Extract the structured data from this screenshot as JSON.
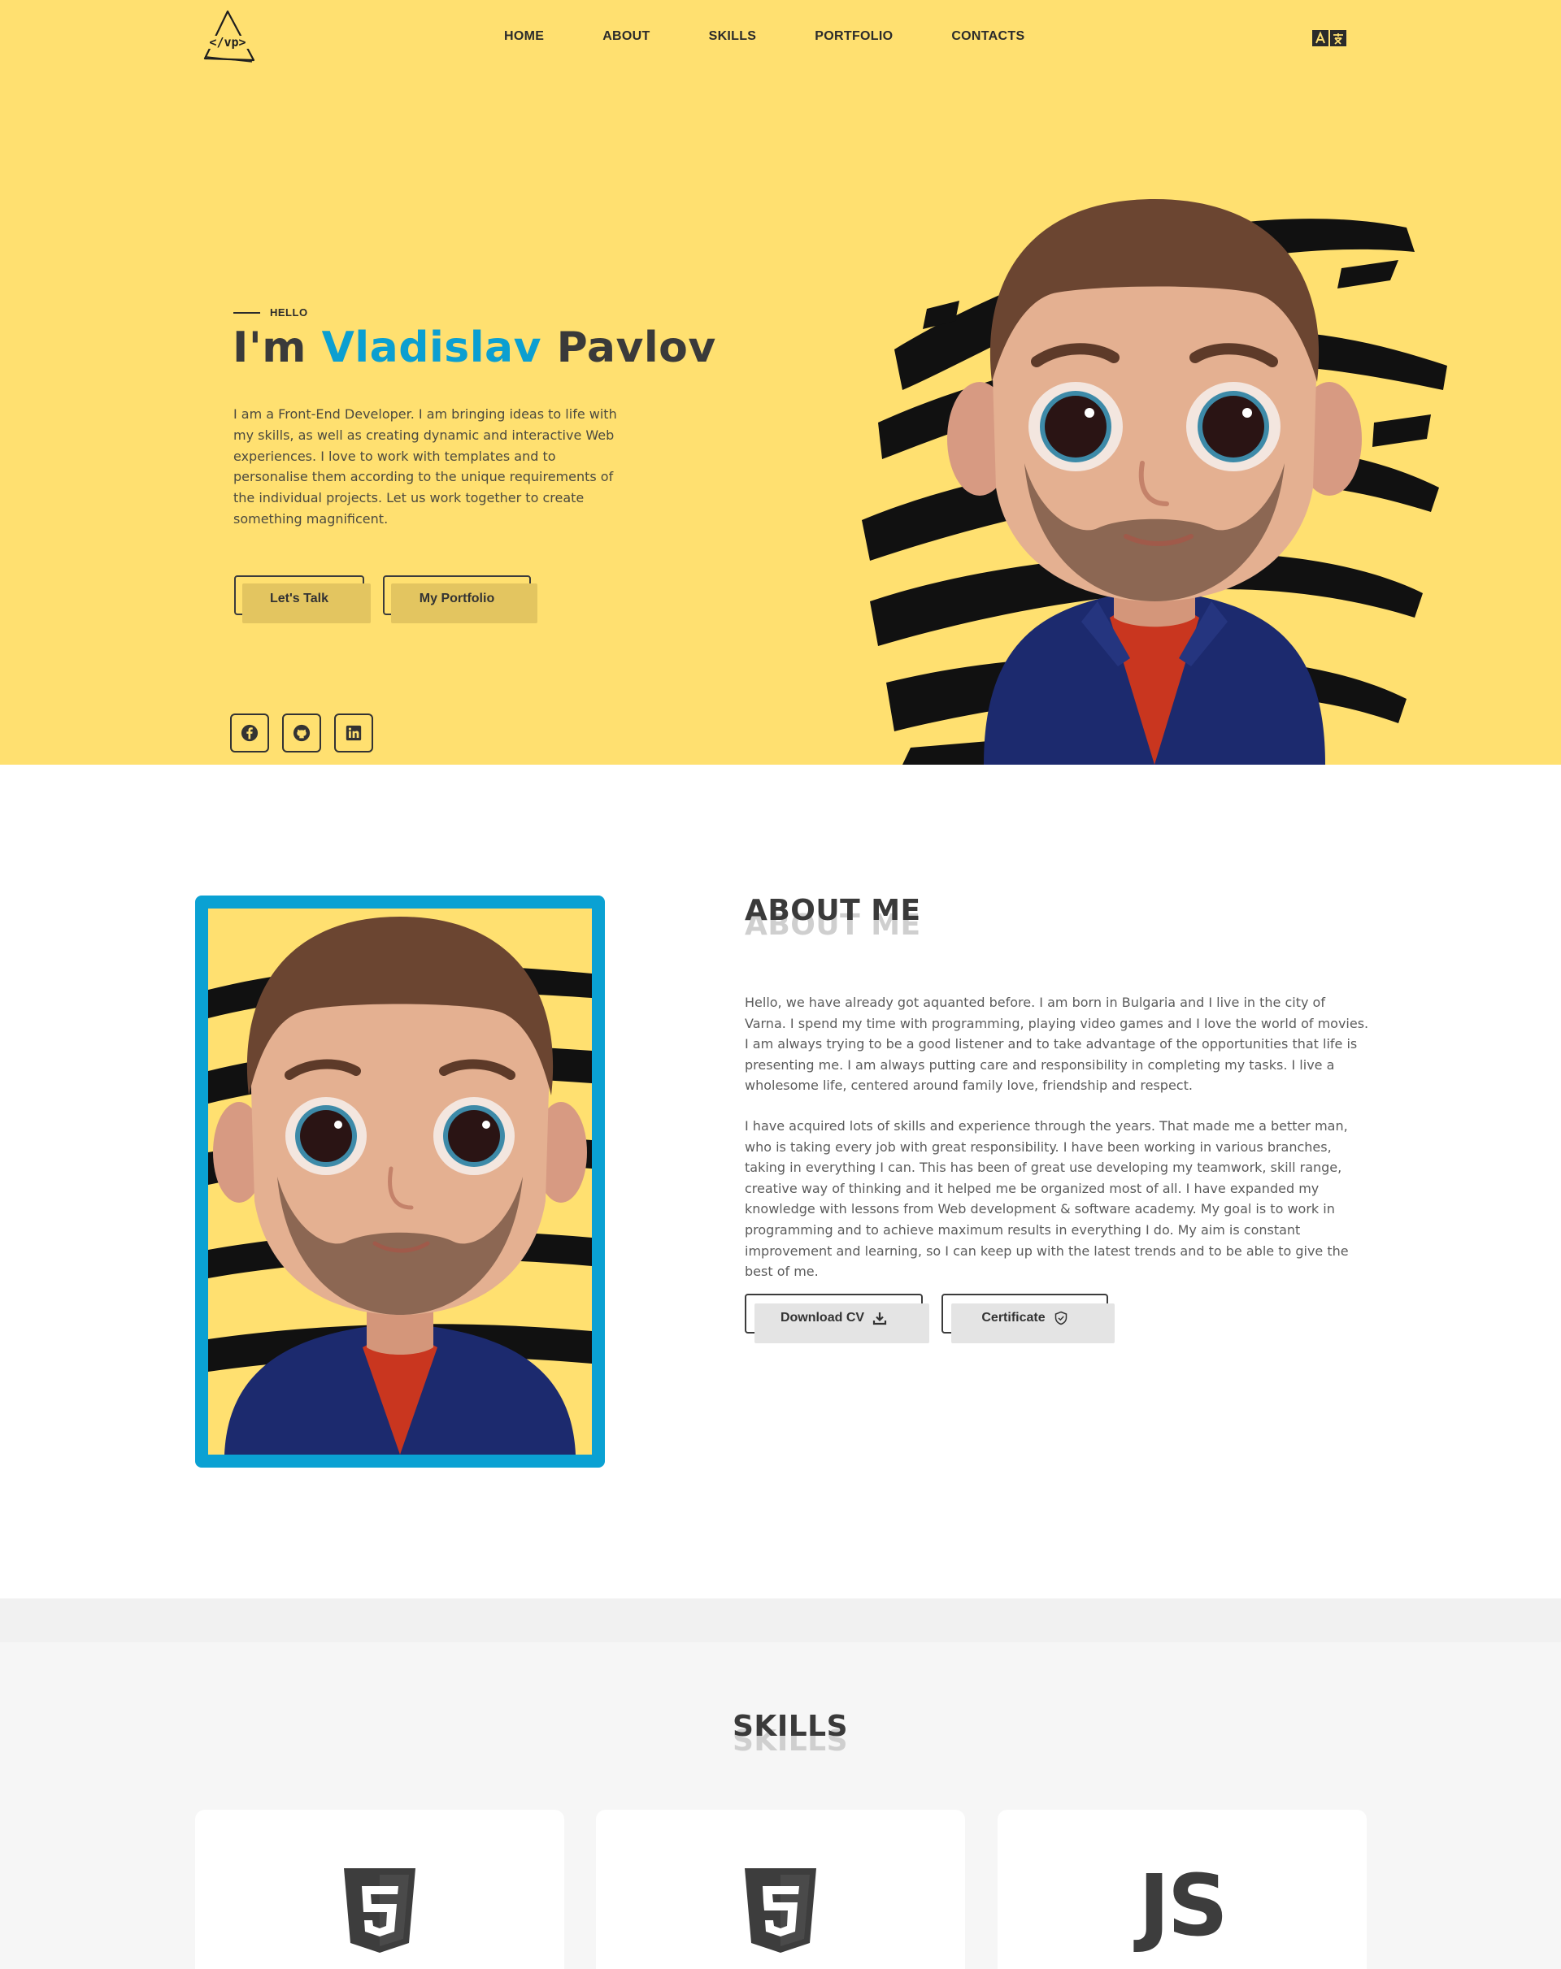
{
  "header": {
    "logo_text": "</vp>",
    "nav": [
      {
        "label": "HOME"
      },
      {
        "label": "ABOUT"
      },
      {
        "label": "SKILLS"
      },
      {
        "label": "PORTFOLIO"
      },
      {
        "label": "CONTACTS"
      }
    ],
    "language_icon": "translate-icon"
  },
  "hero": {
    "eyebrow": "HELLO",
    "headline_prefix": "I'm ",
    "headline_accent": "Vladislav",
    "headline_suffix": " Pavlov",
    "intro": "I am a Front-End Developer. I am bringing ideas to life with my skills, as well as creating dynamic and interactive Web experiences. I love to work with templates and to personalise them according to the unique requirements of the individual projects. Let us work together to create something magnificent.",
    "buttons": {
      "talk": "Let's Talk",
      "portfolio": "My Portfolio"
    },
    "social": [
      "facebook-icon",
      "github-icon",
      "linkedin-icon"
    ]
  },
  "about": {
    "title": "ABOUT ME",
    "p1": "Hello, we have already got aquanted before. I am born in Bulgaria and I live in the city of Varna. I spend my time with programming, playing video games and I love the world of movies. I am always trying to be a good listener and to take advantage of the opportunities that life is presenting me. I am always putting care and responsibility in completing my tasks. I live a wholesome life, centered around family love, friendship and respect.",
    "p2": "I have acquired lots of skills and experience through the years. That made me a better man, who is taking every job with great responsibility. I have been working in various branches, taking in everything I can. This has been of great use developing my teamwork, skill range, creative way of thinking and it helped me be organized most of all. I have expanded my knowledge with lessons from Web development & software academy. My goal is to work in programming and to achieve maximum results in everything I do. My aim is constant improvement and learning, so I can keep up with the latest trends and to be able to give the best of me.",
    "buttons": {
      "cv": "Download CV",
      "certificate": "Certificate"
    }
  },
  "skills": {
    "title": "SKILLS",
    "cards": [
      {
        "icon": "html5-icon"
      },
      {
        "icon": "css3-icon"
      },
      {
        "icon": "js-icon",
        "label": "JS"
      }
    ]
  },
  "colors": {
    "hero_bg": "#ffe070",
    "accent": "#0b9fd1",
    "dark": "#333333",
    "button_fill": "#e3c560"
  }
}
